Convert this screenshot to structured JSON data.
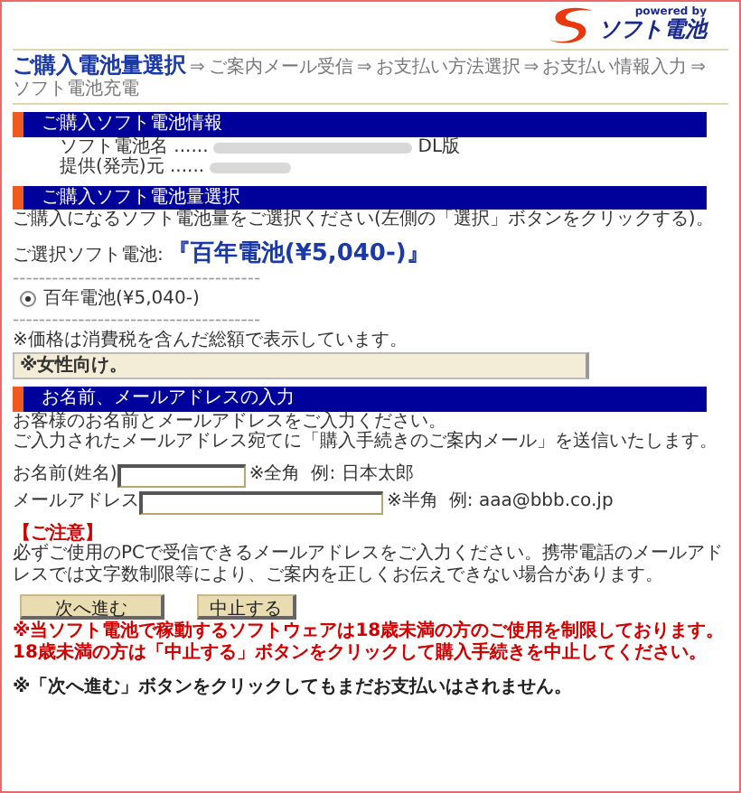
{
  "logo": {
    "tagline": "powered by",
    "brand": "ソフト電池"
  },
  "steps": [
    {
      "label": "ご購入電池量選択",
      "selected": true
    },
    {
      "label": "ご案内メール受信",
      "selected": false
    },
    {
      "label": "お支払い方法選択",
      "selected": false
    },
    {
      "label": "お支払い情報入力",
      "selected": false
    },
    {
      "label": "ソフト電池充電",
      "selected": false
    }
  ],
  "arrow": "⇒",
  "info": {
    "title": "ご購入ソフト電池情報",
    "name_label": "ソフト電池名 ......",
    "name_suffix": "DL版",
    "provider_label": "提供(発売)元 ......"
  },
  "selection": {
    "title": "ご購入ソフト電池量選択",
    "instruction": "ご購入になるソフト電池量をご選択ください(左側の「選択」ボタンをクリックする)。",
    "chosen_label": "ご選択ソフト電池:",
    "chosen_value": "『百年電池(¥5,040-)』",
    "separator": "--------------------------------------",
    "options": [
      {
        "label": "百年電池(¥5,040-)",
        "selected": true
      }
    ],
    "tax_note": "※価格は消費税を含んだ総額で表示しています。",
    "remark": "※女性向け。"
  },
  "contact": {
    "title": "お名前、メールアドレスの入力",
    "intro": [
      "お客様のお名前とメールアドレスをご入力ください。",
      "ご入力されたメールアドレス宛てに「購入手続きのご案内メール」を送信いたします。"
    ],
    "fields": [
      {
        "label": "お名前(姓名)",
        "note": "※全角",
        "example": "例: 日本太郎",
        "kind": "short"
      },
      {
        "label": "メールアドレス",
        "note": "※半角",
        "example": "例: aaa@bbb.co.jp",
        "kind": "long"
      }
    ]
  },
  "caution": {
    "title": "【ご注意】",
    "text": "必ずご使用のPCで受信できるメールアドレスをご入力ください。携帯電話のメールアドレスでは文字数制限等により、ご案内を正しくお伝えできない場合があります。"
  },
  "buttons": [
    {
      "label": "次へ進む",
      "kind": "wide"
    },
    {
      "label": "中止する",
      "kind": "narrow"
    }
  ],
  "warning": "※当ソフト電池で稼動するソフトウェアは18歳未満の方のご使用を制限しております。18歳未満の方は「中止する」ボタンをクリックして購入手続きを中止してください。",
  "footnote": "※「次へ進む」ボタンをクリックしてもまだお支払いはされません。"
}
